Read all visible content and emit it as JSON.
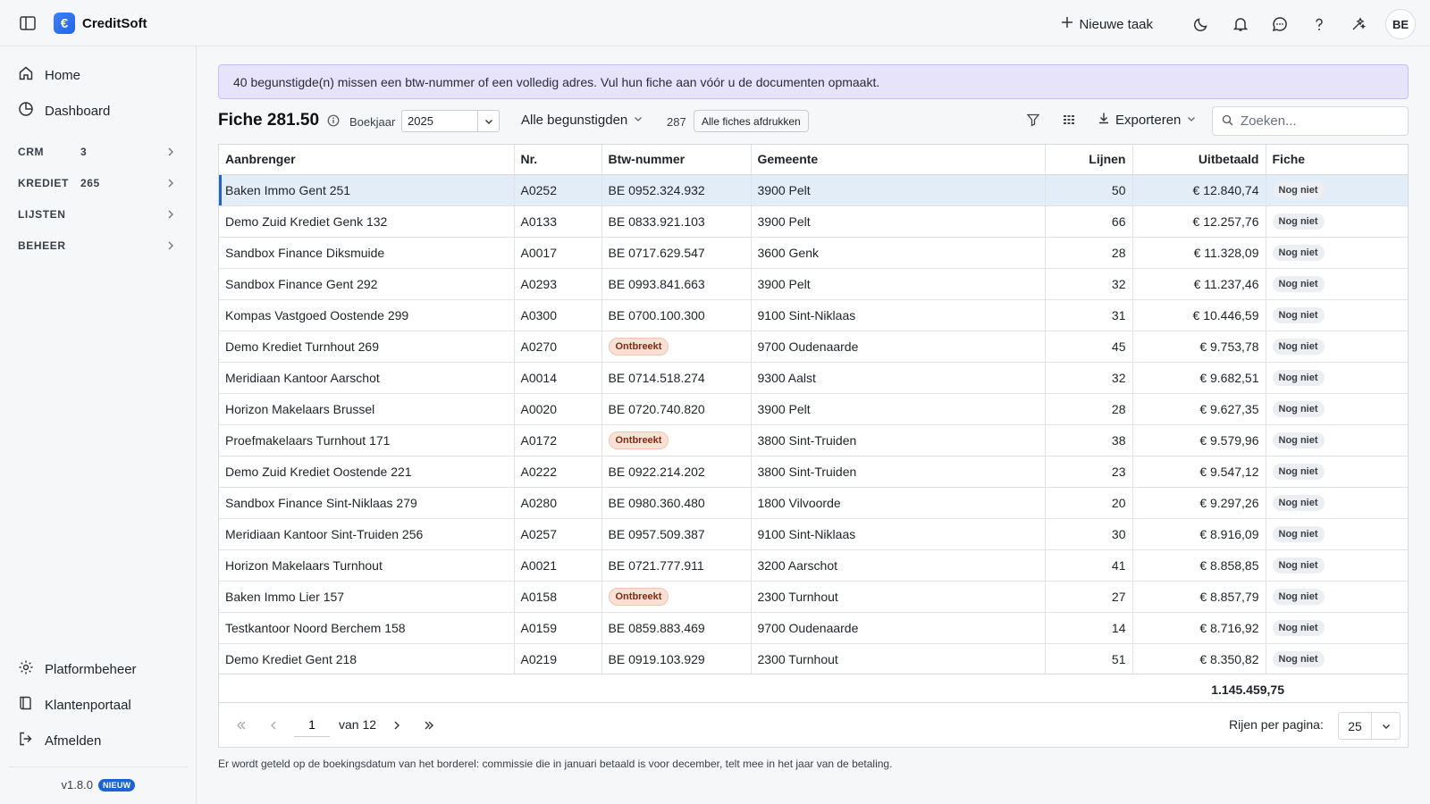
{
  "app": {
    "name": "CreditSoft",
    "logo_glyph": "€"
  },
  "topbar": {
    "new_task_label": "Nieuwe taak",
    "icons": [
      "sidebar-toggle-icon",
      "moon-icon",
      "bell-icon",
      "chat-icon",
      "help-icon",
      "sparkle-icon"
    ],
    "avatar_initials": "BE"
  },
  "sidebar": {
    "main": [
      {
        "label": "Home",
        "icon": "home-icon"
      },
      {
        "label": "Dashboard",
        "icon": "pie-chart-icon"
      }
    ],
    "sections": [
      {
        "label": "CRM",
        "count": "3"
      },
      {
        "label": "KREDIET",
        "count": "265"
      },
      {
        "label": "LIJSTEN",
        "count": ""
      },
      {
        "label": "BEHEER",
        "count": ""
      }
    ],
    "bottom": [
      {
        "label": "Platformbeheer",
        "icon": "gear-icon"
      },
      {
        "label": "Klantenportaal",
        "icon": "book-icon"
      },
      {
        "label": "Afmelden",
        "icon": "logout-icon"
      }
    ],
    "version": "v1.8.0",
    "version_badge": "NIEUW"
  },
  "alert": {
    "text": "40 begunstigde(n) missen een btw-nummer of een volledig adres. Vul hun fiche aan vóór u de documenten opmaakt."
  },
  "toolbar": {
    "title": "Fiche 281.50",
    "boekjaar_label": "Boekjaar",
    "boekjaar_value": "2025",
    "beneficiaries_filter": "Alle begunstigden",
    "count": "287",
    "print_all_label": "Alle fiches afdrukken",
    "export_label": "Exporteren",
    "search_placeholder": "Zoeken..."
  },
  "table": {
    "columns": [
      "Aanbrenger",
      "Nr.",
      "Btw-nummer",
      "Gemeente",
      "Lijnen",
      "Uitbetaald",
      "Fiche"
    ],
    "rows": [
      [
        "Baken Immo Gent 251",
        "A0252",
        "BE 0952.324.932",
        "3900 Pelt",
        "50",
        "€ 12.840,74",
        "Nog niet"
      ],
      [
        "Demo Zuid Krediet Genk 132",
        "A0133",
        "BE 0833.921.103",
        "3900 Pelt",
        "66",
        "€ 12.257,76",
        "Nog niet"
      ],
      [
        "Sandbox Finance Diksmuide",
        "A0017",
        "BE 0717.629.547",
        "3600 Genk",
        "28",
        "€ 11.328,09",
        "Nog niet"
      ],
      [
        "Sandbox Finance Gent 292",
        "A0293",
        "BE 0993.841.663",
        "3900 Pelt",
        "32",
        "€ 11.237,46",
        "Nog niet"
      ],
      [
        "Kompas Vastgoed Oostende 299",
        "A0300",
        "BE 0700.100.300",
        "9100 Sint-Niklaas",
        "31",
        "€ 10.446,59",
        "Nog niet"
      ],
      [
        "Demo Krediet Turnhout 269",
        "A0270",
        "Ontbreekt",
        "9700 Oudenaarde",
        "45",
        "€ 9.753,78",
        "Nog niet"
      ],
      [
        "Meridiaan Kantoor Aarschot",
        "A0014",
        "BE 0714.518.274",
        "9300 Aalst",
        "32",
        "€ 9.682,51",
        "Nog niet"
      ],
      [
        "Horizon Makelaars Brussel",
        "A0020",
        "BE 0720.740.820",
        "3900 Pelt",
        "28",
        "€ 9.627,35",
        "Nog niet"
      ],
      [
        "Proefmakelaars Turnhout 171",
        "A0172",
        "Ontbreekt",
        "3800 Sint-Truiden",
        "38",
        "€ 9.579,96",
        "Nog niet"
      ],
      [
        "Demo Zuid Krediet Oostende 221",
        "A0222",
        "BE 0922.214.202",
        "3800 Sint-Truiden",
        "23",
        "€ 9.547,12",
        "Nog niet"
      ],
      [
        "Sandbox Finance Sint-Niklaas 279",
        "A0280",
        "BE 0980.360.480",
        "1800 Vilvoorde",
        "20",
        "€ 9.297,26",
        "Nog niet"
      ],
      [
        "Meridiaan Kantoor Sint-Truiden 256",
        "A0257",
        "BE 0957.509.387",
        "9100 Sint-Niklaas",
        "30",
        "€ 8.916,09",
        "Nog niet"
      ],
      [
        "Horizon Makelaars Turnhout",
        "A0021",
        "BE 0721.777.911",
        "3200 Aarschot",
        "41",
        "€ 8.858,85",
        "Nog niet"
      ],
      [
        "Baken Immo Lier 157",
        "A0158",
        "Ontbreekt",
        "2300 Turnhout",
        "27",
        "€ 8.857,79",
        "Nog niet"
      ],
      [
        "Testkantoor Noord Berchem 158",
        "A0159",
        "BE 0859.883.469",
        "9700 Oudenaarde",
        "14",
        "€ 8.716,92",
        "Nog niet"
      ],
      [
        "Demo Krediet Gent 218",
        "A0219",
        "BE 0919.103.929",
        "2300 Turnhout",
        "51",
        "€ 8.350,82",
        "Nog niet"
      ],
      [
        "",
        "",
        "",
        "",
        "",
        "",
        ""
      ]
    ],
    "total": "1.145.459,75"
  },
  "pager": {
    "page": "1",
    "of_label": "van 12",
    "rows_per_page_label": "Rijen per pagina:",
    "rows_per_page": "25"
  },
  "footnote": "Er wordt geteld op de boekingsdatum van het borderel: commissie die in januari betaald is voor december, telt mee in het jaar van de betaling."
}
